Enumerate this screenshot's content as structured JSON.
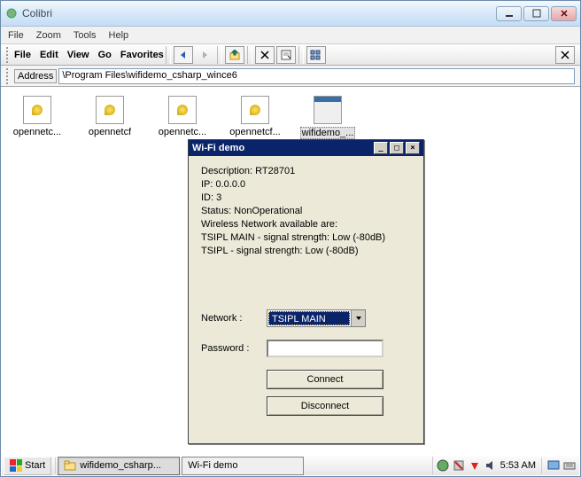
{
  "window": {
    "title": "Colibri"
  },
  "menu": {
    "file": "File",
    "zoom": "Zoom",
    "tools": "Tools",
    "help": "Help"
  },
  "toolbar_menu": {
    "file": "File",
    "edit": "Edit",
    "view": "View",
    "go": "Go",
    "favorites": "Favorites"
  },
  "address": {
    "label": "Address",
    "path": "\\Program Files\\wifidemo_csharp_wince6"
  },
  "files": [
    {
      "label": "opennetc...",
      "type": "dll"
    },
    {
      "label": "opennetcf",
      "type": "dll"
    },
    {
      "label": "opennetc...",
      "type": "dll"
    },
    {
      "label": "opennetcf...",
      "type": "dll"
    },
    {
      "label": "wifidemo_...",
      "type": "win",
      "selected": true
    }
  ],
  "wifi": {
    "title": "Wi-Fi demo",
    "lines": {
      "desc": "Description: RT28701",
      "ip": "IP: 0.0.0.0",
      "id": "ID: 3",
      "status": "Status: NonOperational",
      "avail": "Wireless Network available are:",
      "n1": "TSIPL MAIN -  signal strength: Low (-80dB)",
      "n2": "TSIPL -  signal strength: Low (-80dB)"
    },
    "network_label": "Network  :",
    "network_value": "TSIPL MAIN",
    "password_label": "Password  :",
    "connect": "Connect",
    "disconnect": "Disconnect"
  },
  "taskbar": {
    "start": "Start",
    "btn1": "wifidemo_csharp...",
    "btn2": "Wi-Fi demo",
    "time": "5:53 AM"
  }
}
